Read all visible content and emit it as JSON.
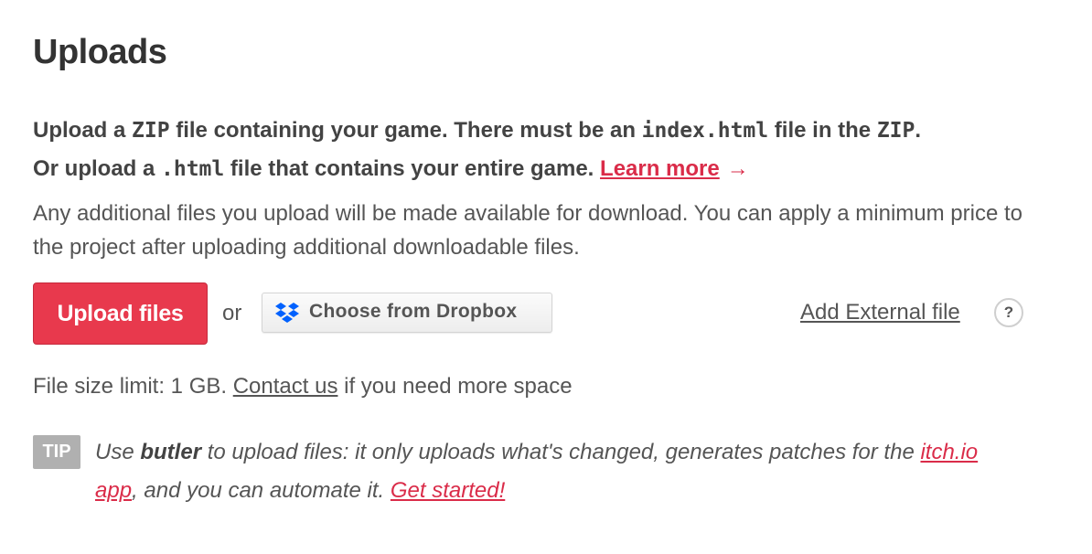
{
  "heading": "Uploads",
  "intro": {
    "line1_part1": "Upload a ",
    "zip1": "ZIP",
    "line1_part2": " file containing your game. There must be an ",
    "index_html": "index.html",
    "line1_part3": " file in the ",
    "zip2": "ZIP",
    "line1_part4": ".",
    "line2_part1": "Or upload a ",
    "html_ext": ".html",
    "line2_part2": " file that contains your entire game. ",
    "learn_more": "Learn more",
    "arrow": "→"
  },
  "additional_text": "Any additional files you upload will be made available for download. You can apply a minimum price to the project after uploading additional downloadable files.",
  "actions": {
    "upload_label": "Upload files",
    "or_text": "or",
    "dropbox_label": "Choose from Dropbox",
    "external_label": "Add External file",
    "help_glyph": "?"
  },
  "size_limit": {
    "prefix": "File size limit: 1 GB. ",
    "contact_link": "Contact us",
    "suffix": " if you need more space"
  },
  "tip": {
    "badge": "TIP",
    "part1": "Use ",
    "butler": "butler",
    "part2": " to upload files: it only uploads what's changed, generates patches for the ",
    "itch_link": "itch.io app",
    "part3": ", and you can automate it. ",
    "get_started": "Get started!"
  },
  "colors": {
    "accent": "#e8394d",
    "link_red": "#da2c49",
    "dropbox_blue": "#0061fe",
    "tip_badge": "#b0b0b0"
  },
  "icons": {
    "dropbox": "dropbox-icon",
    "help": "help-icon",
    "arrow": "arrow-right-icon"
  }
}
